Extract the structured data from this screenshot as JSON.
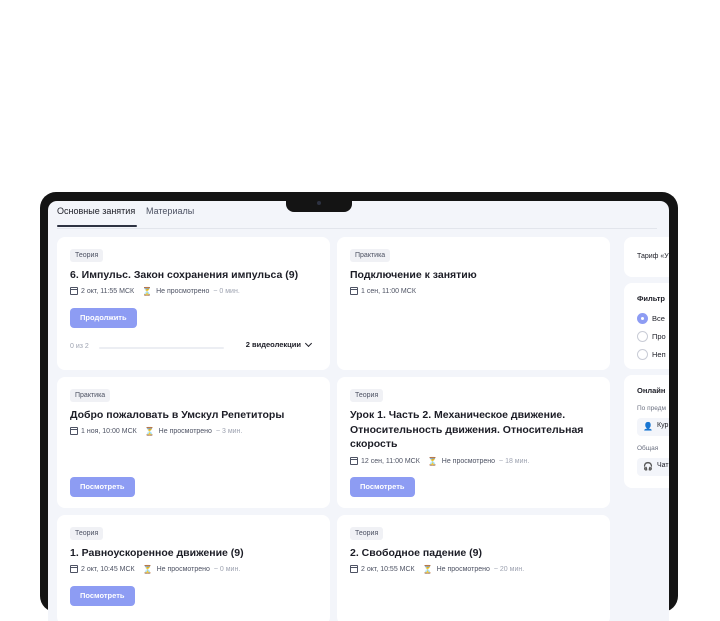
{
  "tabs": [
    {
      "label": "Основные занятия",
      "active": true
    },
    {
      "label": "Материалы",
      "active": false
    }
  ],
  "cards": [
    {
      "badge": "Теория",
      "title": "6. Импульс. Закон сохранения импульса (9)",
      "date": "2 окт, 11:55 МСК",
      "status": "Не просмотрено",
      "duration": "~ 0 мин.",
      "button": "Продолжить",
      "progress_label": "0 из 2",
      "progress": 0,
      "lectures": "2 видеолекции"
    },
    {
      "badge": "Практика",
      "title": "Подключение к занятию",
      "date": "1 сен, 11:00 МСК"
    },
    {
      "badge": "Практика",
      "title": "Добро пожаловать в Умскул Репетиторы",
      "date": "1 ноя, 10:00 МСК",
      "status": "Не просмотрено",
      "duration": "~ 3 мин.",
      "button": "Посмотреть"
    },
    {
      "badge": "Теория",
      "title_lines": [
        "Урок 1. Часть 2. Механическое движение.",
        "Относительность движения. Относительная",
        "скорость"
      ],
      "date": "12 сен, 11:00 МСК",
      "status": "Не просмотрено",
      "duration": "~ 18 мин.",
      "button": "Посмотреть"
    },
    {
      "badge": "Теория",
      "title": "1. Равноускоренное движение (9)",
      "date": "2 окт, 10:45 МСК",
      "status": "Не просмотрено",
      "duration": "~ 0 мин.",
      "button": "Посмотреть"
    },
    {
      "badge": "Теория",
      "title": "2. Свободное падение (9)",
      "date": "2 окт, 10:55 МСК",
      "status": "Не просмотрено",
      "duration": "~ 20 мин."
    }
  ],
  "sidebar": {
    "tariff": "Тариф «У",
    "filter_title": "Фильтр",
    "filters": [
      {
        "label": "Все",
        "selected": true
      },
      {
        "label": "Про",
        "selected": false
      },
      {
        "label": "Неп",
        "selected": false
      }
    ],
    "online_title": "Онлайн",
    "by_subject": "По предм",
    "chip1": "Кур",
    "general": "Общая",
    "chip2": "Чат"
  },
  "icons": {
    "calendar": "calendar-icon",
    "hourglass": "hourglass-icon",
    "user": "user-icon",
    "headset": "headset-icon"
  },
  "colors": {
    "accent": "#8d9cf3",
    "hourglass": "#d98a1d",
    "frame": "#141414",
    "background": "#f3f5fa"
  }
}
